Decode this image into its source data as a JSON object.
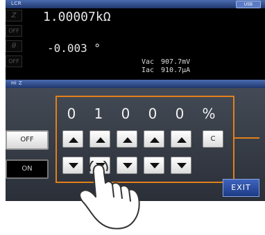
{
  "header": {
    "title": "LCR",
    "usb_label": "USB"
  },
  "measurements": [
    {
      "param": "Z",
      "value": "1.00007kΩ"
    },
    {
      "param": "OFF",
      "value": ""
    },
    {
      "param": "θ",
      "value": "-0.003 °"
    },
    {
      "param": "OFF",
      "value": ""
    }
  ],
  "monitor": {
    "vac_label": "Vac",
    "vac_value": "907.7mV",
    "iac_label": "Iac",
    "iac_value": "910.7μA"
  },
  "panel": {
    "title": "Hi Z",
    "off_label": "OFF",
    "on_label": "ON",
    "digits": [
      "0",
      "1",
      "0",
      "0",
      "0"
    ],
    "unit": "%",
    "clear_label": "C",
    "exit_label": "EXIT"
  }
}
